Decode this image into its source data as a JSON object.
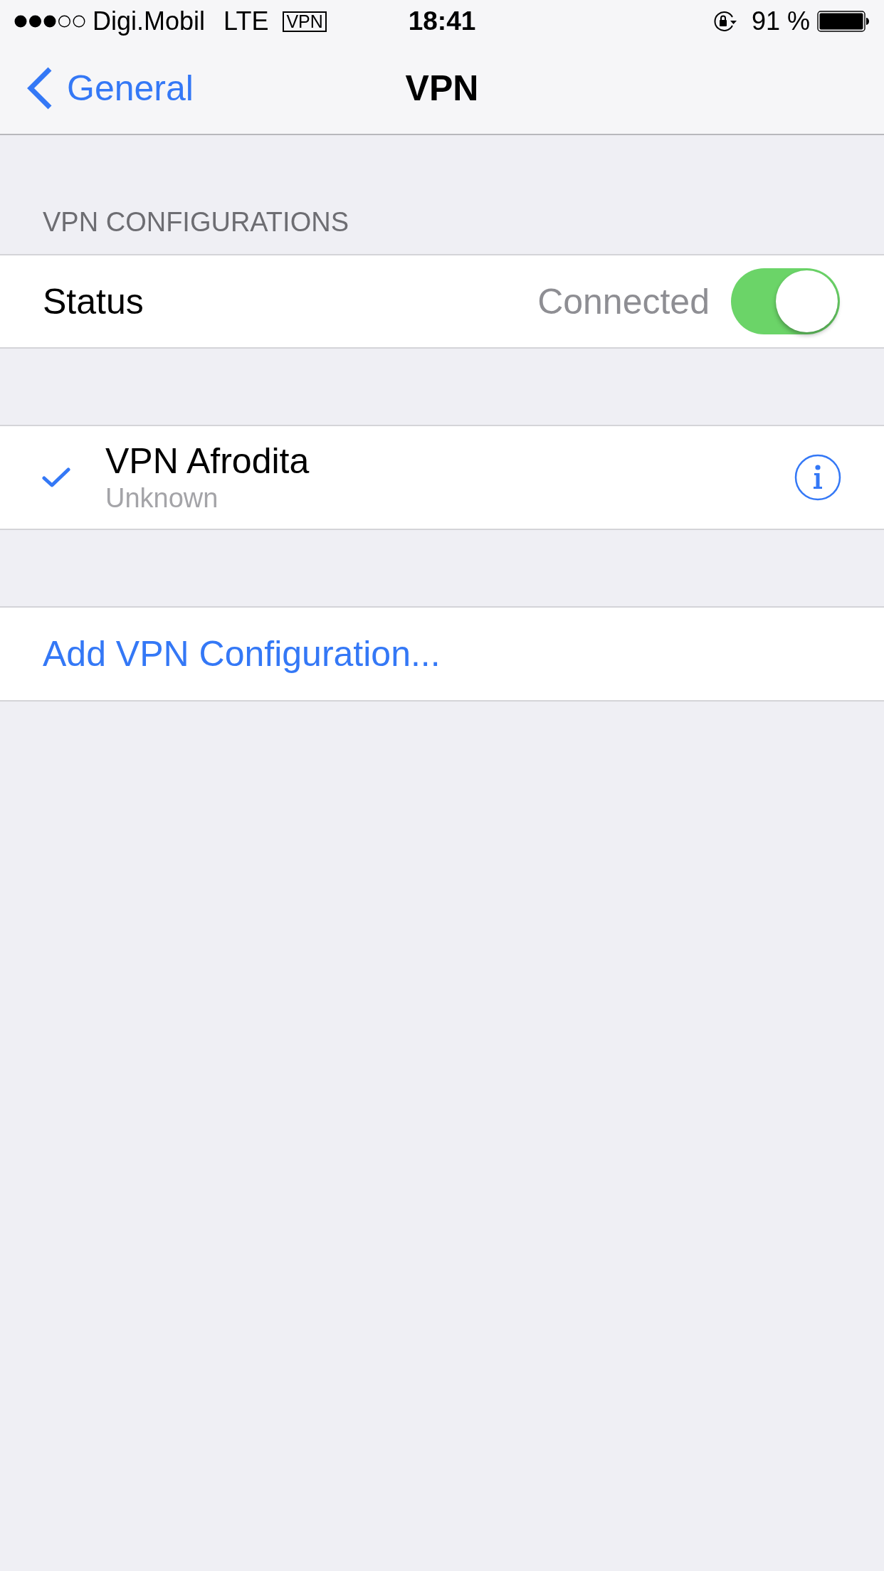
{
  "status_bar": {
    "carrier": "Digi.Mobil",
    "network": "LTE",
    "vpn_badge": "VPN",
    "time": "18:41",
    "battery_percent": "91 %"
  },
  "nav": {
    "back": "General",
    "title": "VPN"
  },
  "section_header": "VPN CONFIGURATIONS",
  "status_row": {
    "label": "Status",
    "value": "Connected",
    "on": true
  },
  "configurations": [
    {
      "name": "VPN Afrodita",
      "detail": "Unknown",
      "selected": true
    }
  ],
  "add_button": "Add VPN Configuration..."
}
